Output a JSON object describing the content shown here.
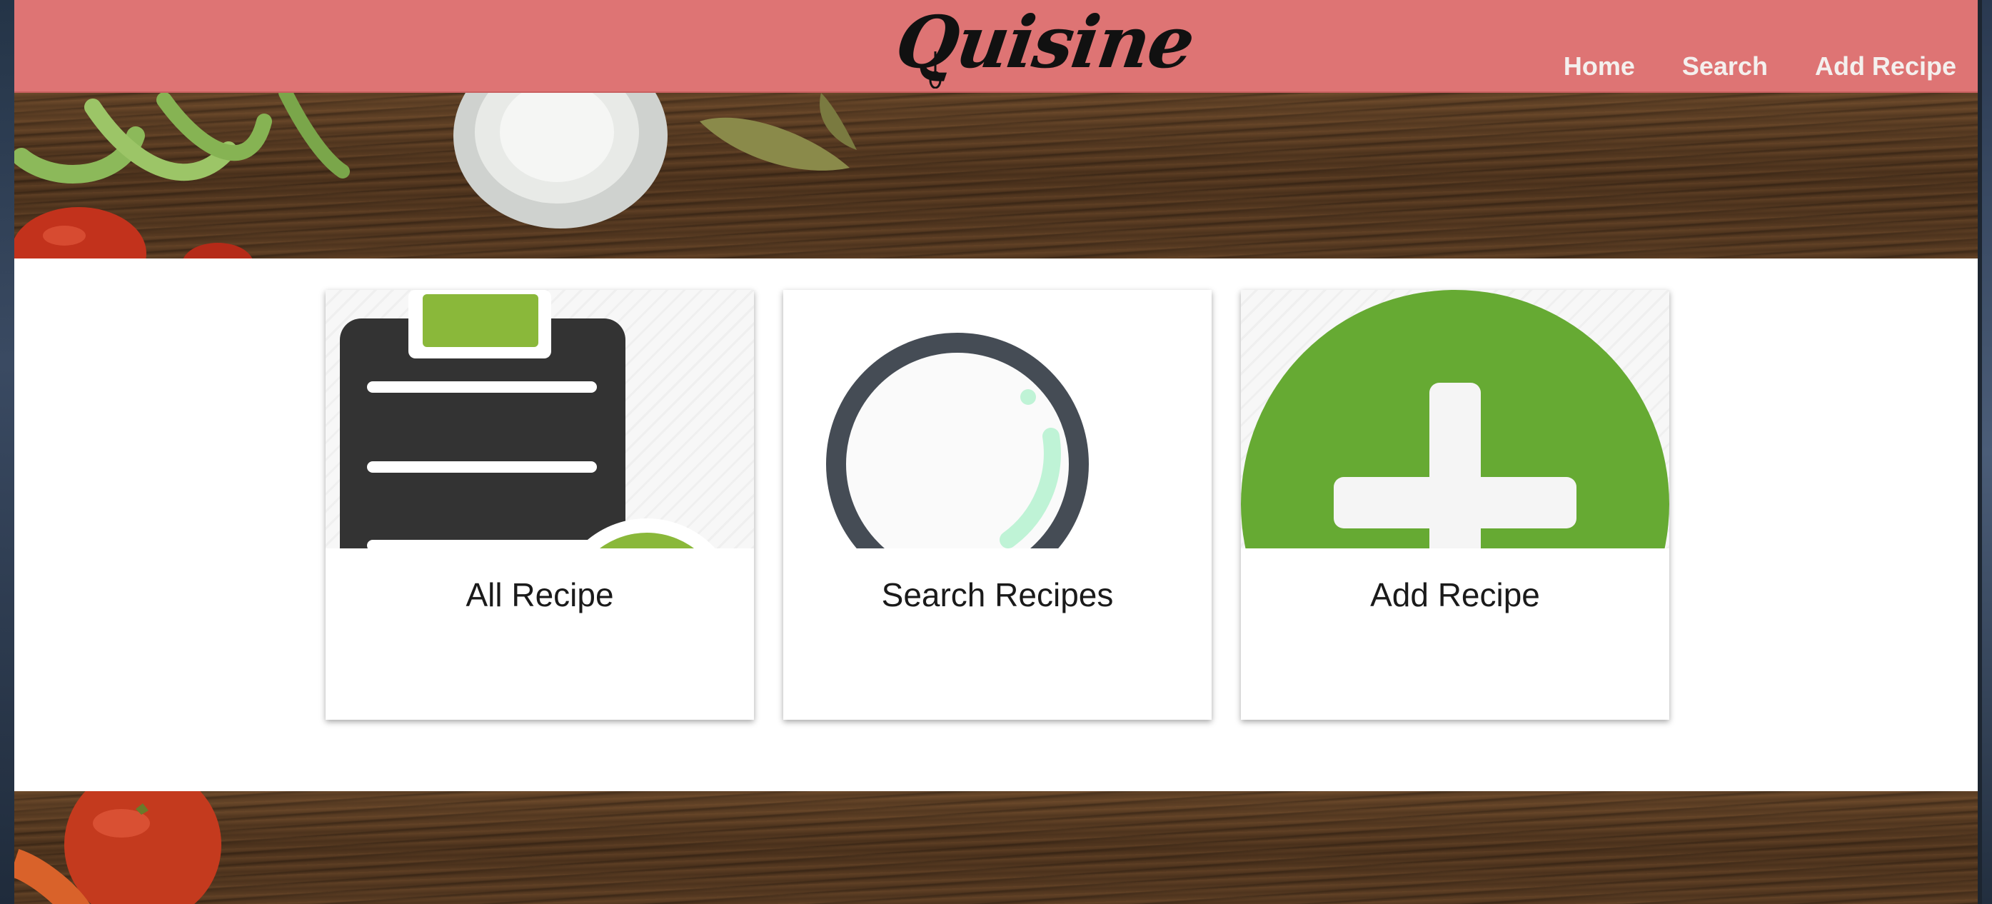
{
  "app": {
    "logo_text": "Quisine"
  },
  "nav": {
    "items": [
      {
        "label": "Home"
      },
      {
        "label": "Search"
      },
      {
        "label": "Add Recipe"
      }
    ]
  },
  "cards": [
    {
      "label": "All Recipe",
      "icon": "clipboard-list-icon"
    },
    {
      "label": "Search Recipes",
      "icon": "magnifier-icon"
    },
    {
      "label": "Add Recipe",
      "icon": "plus-circle-icon"
    }
  ],
  "colors": {
    "header_bg": "#de7474",
    "nav_text": "#f4f0ee",
    "accent_green": "#66aa33",
    "clipboard_dark": "#333333",
    "magnifier_ring": "#454c55"
  }
}
